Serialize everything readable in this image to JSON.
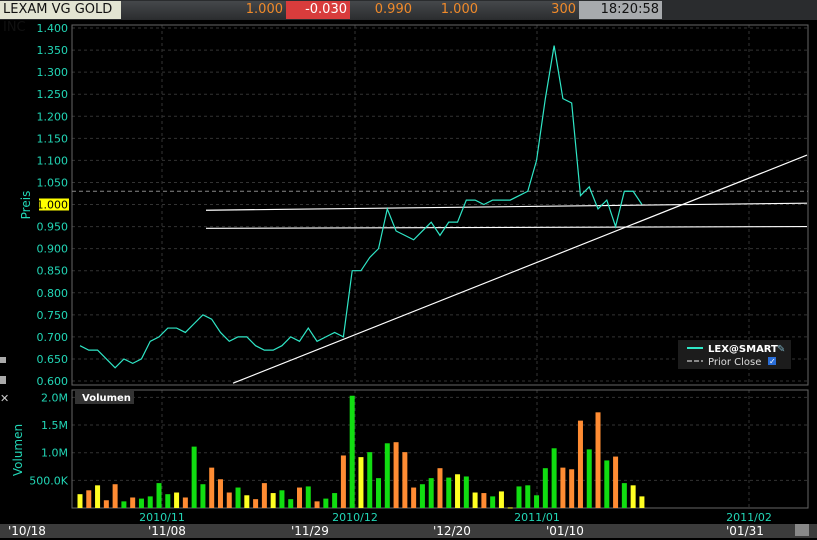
{
  "header": {
    "symbol_name": "LEXAM VG GOLD INC",
    "last": "1.000",
    "change": "-0.030",
    "bid": "0.990",
    "ask": "1.000",
    "size": "300",
    "time": "18:20:58"
  },
  "colors": {
    "price_line": "#2fe6c6",
    "axis_text": "#22d6b6",
    "up": "#11dd11",
    "down": "#ff8c33",
    "unchanged": "#ffff22",
    "change_bg": "#d83c3c"
  },
  "legend": {
    "series": "LEX@SMART",
    "prior_close": "Prior Close",
    "prior_close_checked": true
  },
  "scrollbar_labels": [
    "'10/18",
    "'11/08",
    "'11/29",
    "'12/20",
    "'01/10",
    "'01/31"
  ],
  "chart_data": [
    {
      "type": "line",
      "ylabel": "Preis",
      "ylim": [
        0.6,
        1.4
      ],
      "yticks": [
        "0.600",
        "0.650",
        "0.700",
        "0.750",
        "0.800",
        "0.850",
        "0.900",
        "0.950",
        "1.000",
        "1.050",
        "1.100",
        "1.150",
        "1.200",
        "1.250",
        "1.300",
        "1.350",
        "1.400"
      ],
      "highlight_tick": "1.000",
      "xticks": [
        "2010/11",
        "2010/12",
        "2011/01",
        "2011/02"
      ],
      "grid": true,
      "legend_position": "bottom-right",
      "prior_close": 1.03,
      "series": [
        {
          "name": "LEX@SMART",
          "values": [
            0.68,
            0.67,
            0.67,
            0.65,
            0.63,
            0.65,
            0.64,
            0.65,
            0.69,
            0.7,
            0.72,
            0.72,
            0.71,
            0.73,
            0.75,
            0.74,
            0.71,
            0.69,
            0.7,
            0.7,
            0.68,
            0.67,
            0.67,
            0.68,
            0.7,
            0.69,
            0.72,
            0.69,
            0.7,
            0.71,
            0.7,
            0.85,
            0.85,
            0.88,
            0.9,
            0.99,
            0.94,
            0.93,
            0.92,
            0.94,
            0.96,
            0.93,
            0.96,
            0.96,
            1.01,
            1.01,
            1.0,
            1.01,
            1.01,
            1.01,
            1.02,
            1.03,
            1.1,
            1.24,
            1.36,
            1.24,
            1.23,
            1.02,
            1.04,
            0.99,
            1.01,
            0.95,
            1.03,
            1.03,
            1.0
          ]
        }
      ],
      "trend_lines": [
        {
          "from_price": 0.987,
          "to_price": 1.003
        },
        {
          "from_price": 0.946,
          "to_price": 0.95
        },
        {
          "from_price": 0.595,
          "to_price": 1.112
        }
      ]
    },
    {
      "type": "bar",
      "title": "Volumen",
      "ylabel": "Volumen",
      "ylim": [
        0,
        2000000
      ],
      "yticks": [
        "500.0K",
        "1.0M",
        "1.5M",
        "2.0M"
      ],
      "values_millions": [
        0.25,
        0.32,
        0.41,
        0.14,
        0.43,
        0.12,
        0.19,
        0.17,
        0.21,
        0.45,
        0.25,
        0.28,
        0.19,
        1.11,
        0.43,
        0.73,
        0.52,
        0.28,
        0.37,
        0.23,
        0.16,
        0.45,
        0.27,
        0.32,
        0.16,
        0.37,
        0.39,
        0.12,
        0.17,
        0.27,
        0.95,
        2.03,
        0.92,
        1.01,
        0.54,
        1.17,
        1.19,
        1.01,
        0.37,
        0.43,
        0.54,
        0.72,
        0.55,
        0.61,
        0.57,
        0.28,
        0.27,
        0.21,
        0.3,
        0.01,
        0.39,
        0.41,
        0.23,
        0.72,
        1.08,
        0.73,
        0.7,
        1.58,
        1.06,
        1.73,
        0.86,
        0.93,
        0.45,
        0.41,
        0.21
      ],
      "bar_colors": [
        "unchanged",
        "down",
        "unchanged",
        "down",
        "down",
        "up",
        "down",
        "up",
        "up",
        "up",
        "up",
        "unchanged",
        "down",
        "up",
        "up",
        "down",
        "down",
        "down",
        "up",
        "unchanged",
        "down",
        "down",
        "unchanged",
        "up",
        "up",
        "down",
        "up",
        "down",
        "up",
        "up",
        "down",
        "up",
        "unchanged",
        "up",
        "up",
        "up",
        "down",
        "down",
        "down",
        "up",
        "up",
        "down",
        "up",
        "unchanged",
        "up",
        "unchanged",
        "down",
        "up",
        "unchanged",
        "unchanged",
        "up",
        "up",
        "up",
        "up",
        "up",
        "down",
        "down",
        "down",
        "up",
        "down",
        "up",
        "down",
        "up",
        "unchanged",
        "unchanged"
      ]
    }
  ]
}
